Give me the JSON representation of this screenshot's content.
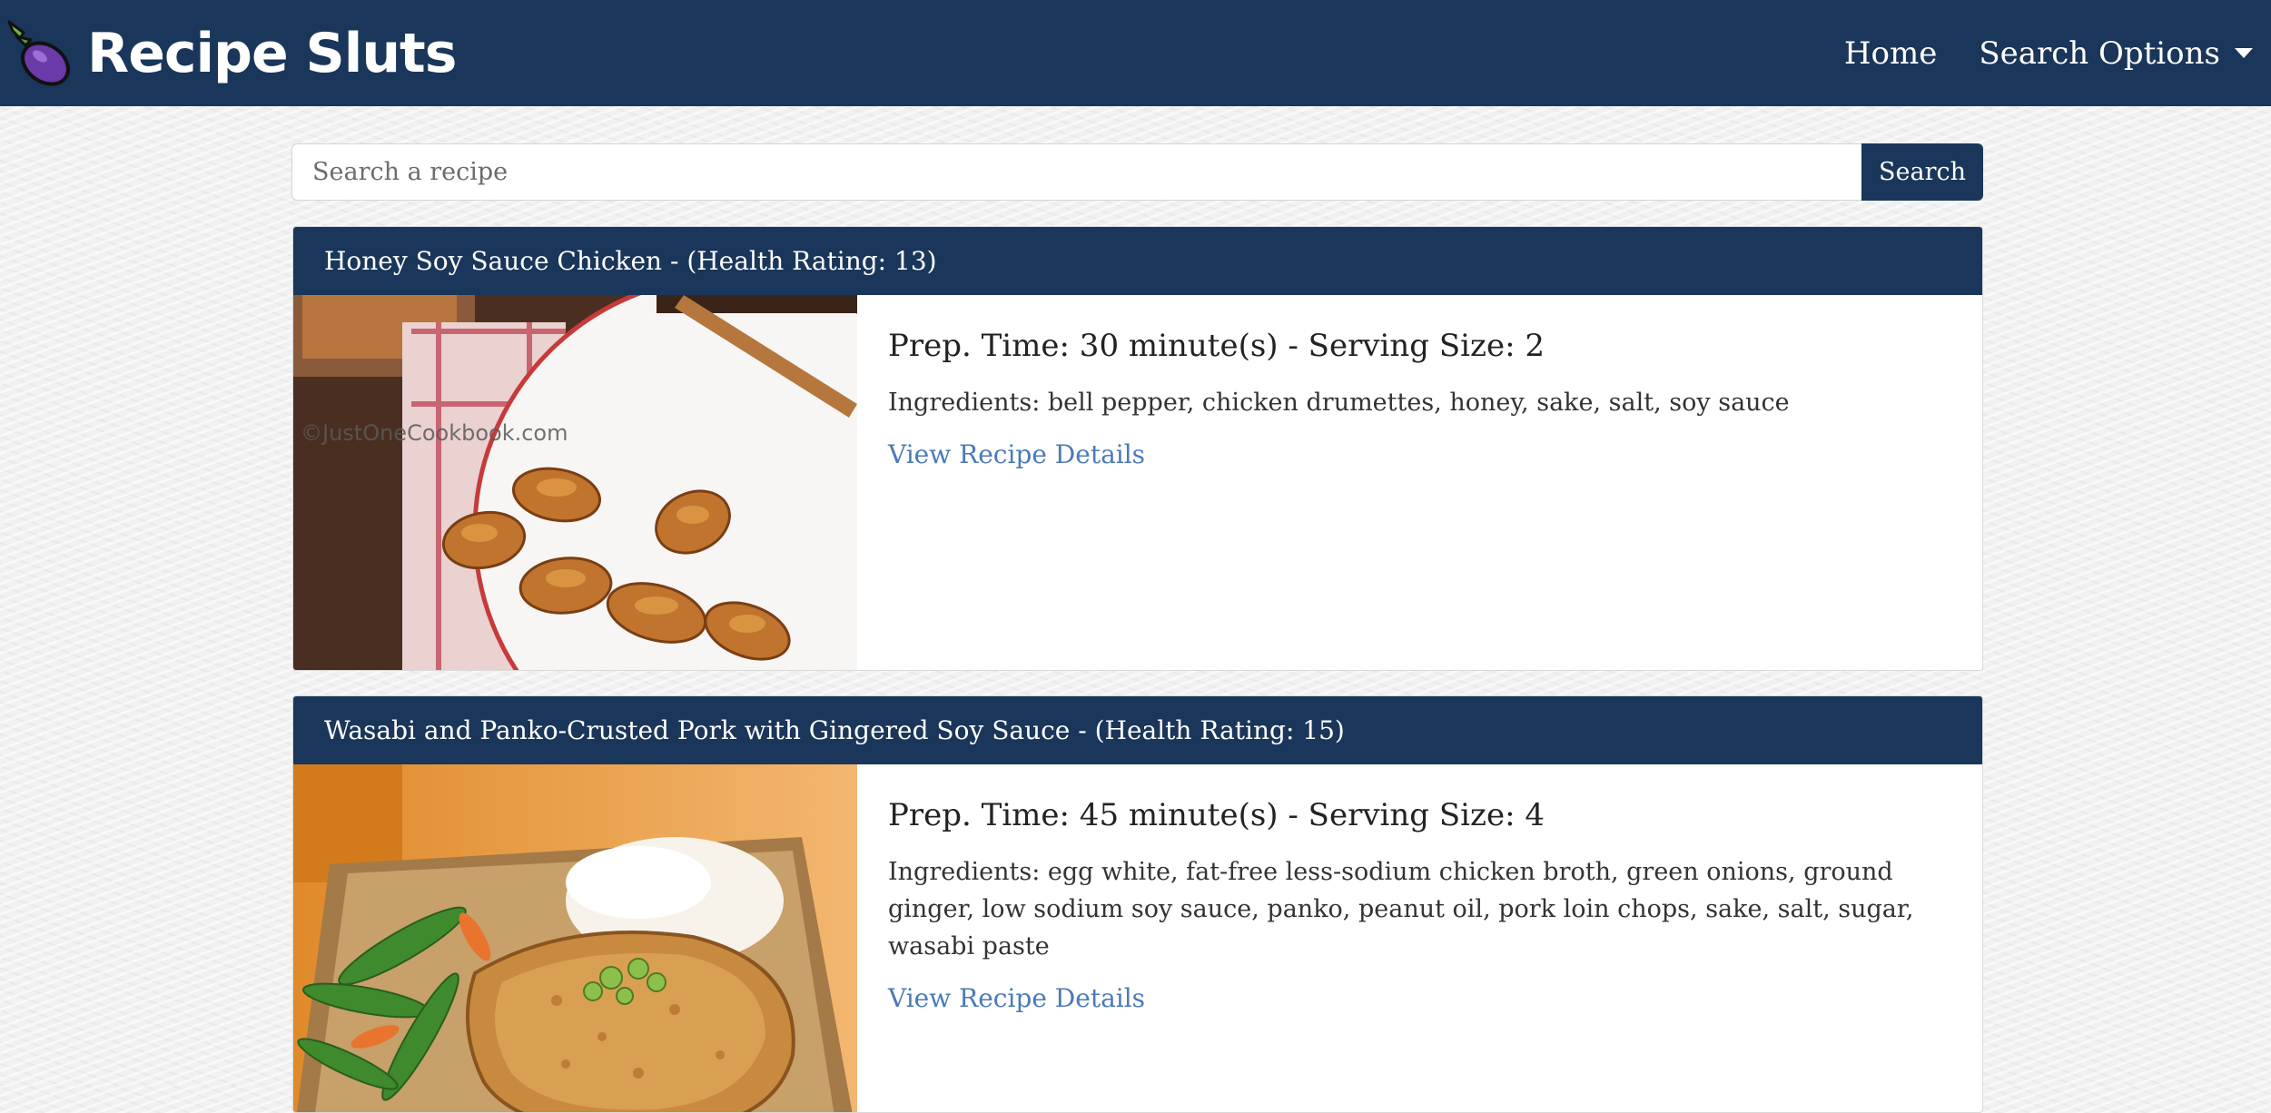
{
  "app": {
    "brand": "Recipe Sluts",
    "brand_icon": "eggplant-icon"
  },
  "nav": {
    "home_label": "Home",
    "search_options_label": "Search Options"
  },
  "search": {
    "placeholder": "Search a recipe",
    "button_label": "Search"
  },
  "colors": {
    "primary": "#1a365a",
    "link": "#4a7ab8",
    "background": "#f1f1f1"
  },
  "recipes": [
    {
      "title": "Honey Soy Sauce Chicken - (Health Rating: 13)",
      "meta": "Prep. Time: 30 minute(s) - Serving Size: 2",
      "ingredients": "Ingredients: bell pepper, chicken drumettes, honey, sake, salt, soy sauce",
      "link_label": "View Recipe Details",
      "image_watermark": "©JustOneCookbook.com"
    },
    {
      "title": "Wasabi and Panko-Crusted Pork with Gingered Soy Sauce - (Health Rating: 15)",
      "meta": "Prep. Time: 45 minute(s) - Serving Size: 4",
      "ingredients": "Ingredients: egg white, fat-free less-sodium chicken broth, green onions, ground ginger, low sodium soy sauce, panko, peanut oil, pork loin chops, sake, salt, sugar, wasabi paste",
      "link_label": "View Recipe Details"
    }
  ]
}
